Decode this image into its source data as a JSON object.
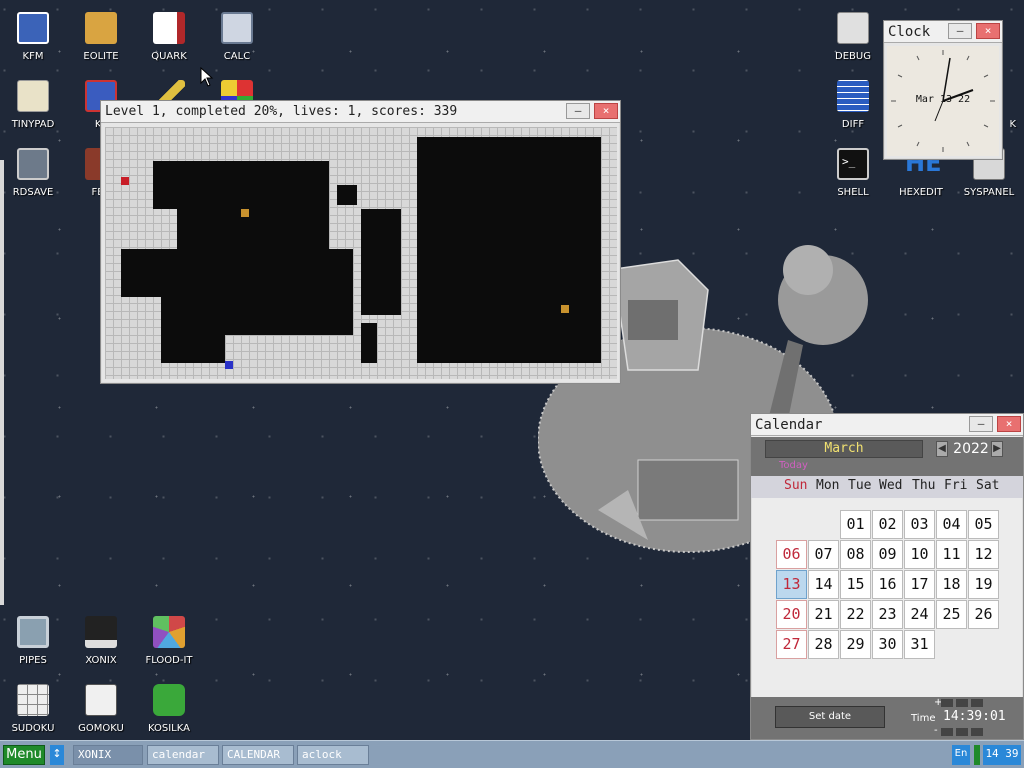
{
  "desktop": {
    "icons_left": [
      {
        "label": "KFM",
        "icon": "floppy-icon",
        "color": "#3b63b8"
      },
      {
        "label": "EOLITE",
        "icon": "folder-icon",
        "color": "#d9a441"
      },
      {
        "label": "QUARK",
        "icon": "book-icon",
        "color": "#b0282a"
      },
      {
        "label": "CALC",
        "icon": "calculator-icon",
        "color": "#cfd6e2"
      },
      {
        "label": "TINYPAD",
        "icon": "notepad-icon",
        "color": "#e9e2c8"
      },
      {
        "label": "KF",
        "icon": "kfar-icon",
        "color": "#3a5cbf"
      },
      {
        "label": "RDSAVE",
        "icon": "rdsave-icon",
        "color": "#6d7a8a"
      },
      {
        "label": "FB2",
        "icon": "fb2-icon",
        "color": "#8a3a2a"
      }
    ],
    "icons_right": [
      {
        "label": "DEBUG",
        "icon": "bug-icon",
        "color": "#e0e0e0"
      },
      {
        "label": "DIFF",
        "icon": "diff-icon",
        "color": "#2a5cc0"
      },
      {
        "label": "K",
        "icon": "k-icon",
        "color": "#cccccc"
      },
      {
        "label": "SHELL",
        "icon": "terminal-icon",
        "color": "#111111"
      },
      {
        "label": "HEXEDIT",
        "icon": "hexedit-icon",
        "color": "#2a78d8"
      },
      {
        "label": "SYSPANEL",
        "icon": "syspanel-icon",
        "color": "#d8d8d8"
      }
    ],
    "icons_bottom": [
      {
        "label": "PIPES",
        "icon": "pipes-icon",
        "color": "#8aa0b0"
      },
      {
        "label": "XONIX",
        "icon": "xonix-icon",
        "color": "#222222"
      },
      {
        "label": "FLOOD-IT",
        "icon": "flood-it-icon",
        "color": "#d04848"
      },
      {
        "label": "SUDOKU",
        "icon": "sudoku-icon",
        "color": "#eeeeee"
      },
      {
        "label": "GOMOKU",
        "icon": "gomoku-icon",
        "color": "#f0f0f0"
      },
      {
        "label": "KOSILKA",
        "icon": "lawnmower-icon",
        "color": "#3aa83a"
      }
    ]
  },
  "xonix": {
    "title": "Level 1, completed 20%, lives: 1, scores: 339",
    "level": 1,
    "completed_percent": 20,
    "lives": 1,
    "score": 339,
    "minimize_label": "–",
    "close_label": "×"
  },
  "clock": {
    "title": "Clock",
    "date_label": "Mar 13 22",
    "minimize_label": "–",
    "close_label": "×"
  },
  "calendar": {
    "title": "Calendar",
    "month": "March",
    "year": "2022",
    "today_label": "Today",
    "weekdays": [
      "Sun",
      "Mon",
      "Tue",
      "Wed",
      "Thu",
      "Fri",
      "Sat"
    ],
    "days": [
      "01",
      "02",
      "03",
      "04",
      "05",
      "06",
      "07",
      "08",
      "09",
      "10",
      "11",
      "12",
      "13",
      "14",
      "15",
      "16",
      "17",
      "18",
      "19",
      "20",
      "21",
      "22",
      "23",
      "24",
      "25",
      "26",
      "27",
      "28",
      "29",
      "30",
      "31"
    ],
    "selected_day": "13",
    "set_date_label": "Set date",
    "time_label": "Time",
    "time_value": "14:39:01",
    "plus_label": "+",
    "minus_label": "-",
    "minimize_label": "–",
    "close_label": "×"
  },
  "taskbar": {
    "menu_label": "Menu",
    "switch_label": "↕",
    "tasks": [
      "XONIX",
      "calendar",
      "CALENDAR",
      "aclock"
    ],
    "lang": "En",
    "clock": "14 39"
  },
  "colors": {
    "accent_menu": "#1f8a2a",
    "taskbar": "#8aa0b8",
    "sunday": "#c0283a",
    "today_label": "#d060c0",
    "month_text": "#f0e070"
  }
}
